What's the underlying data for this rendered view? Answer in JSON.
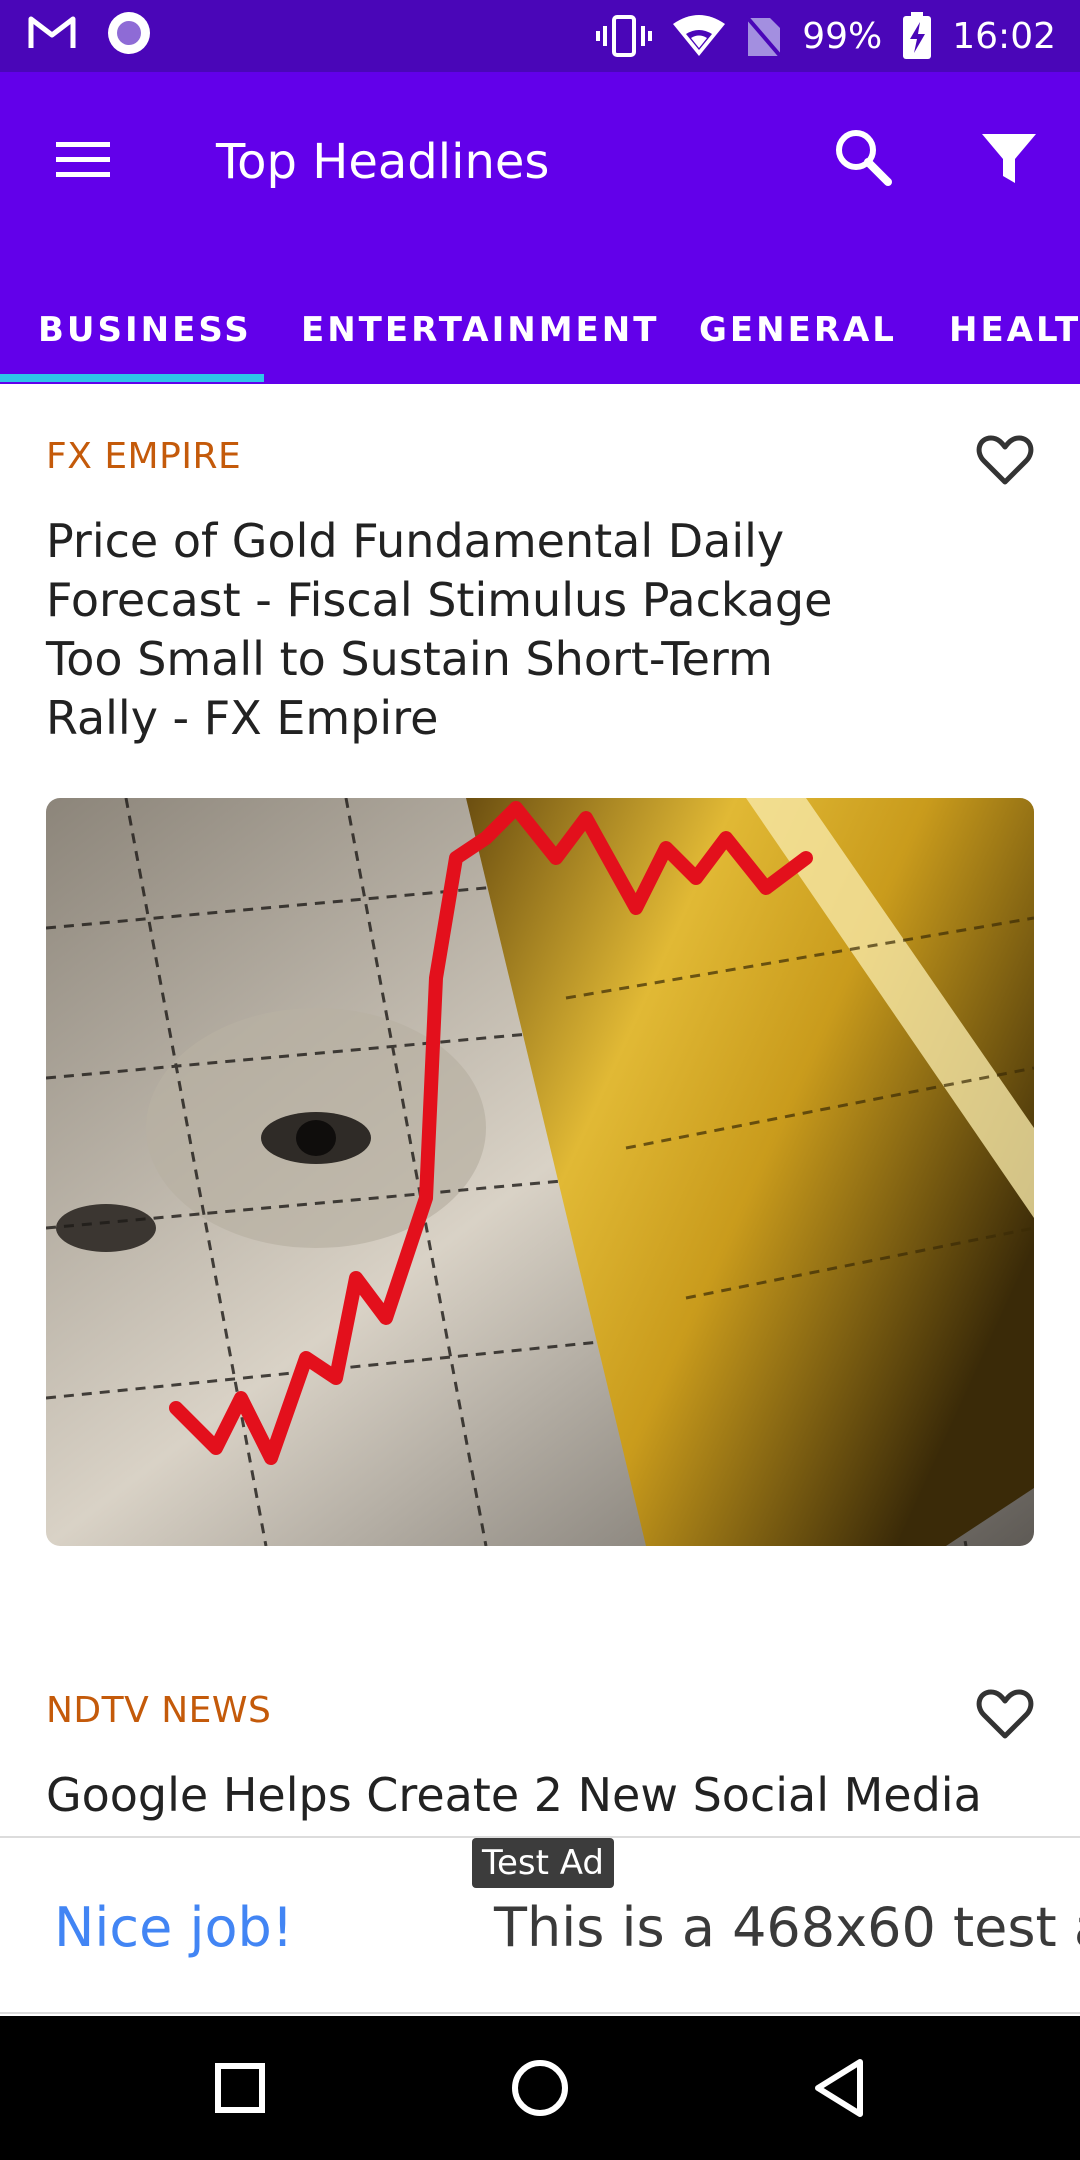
{
  "status_bar": {
    "battery_percent": "99%",
    "time": "16:02",
    "icons": [
      "gmail-icon",
      "app-circle-icon",
      "vibrate-icon",
      "wifi-icon",
      "no-sim-icon",
      "battery-charging-icon"
    ]
  },
  "app_bar": {
    "title": "Top Headlines",
    "icons": [
      "menu-icon",
      "search-icon",
      "filter-icon"
    ],
    "background": "#6200ea"
  },
  "tabs": [
    {
      "label": "BUSINESS",
      "selected": true
    },
    {
      "label": "ENTERTAINMENT",
      "selected": false
    },
    {
      "label": "GENERAL",
      "selected": false
    },
    {
      "label": "HEALTH",
      "selected": false
    }
  ],
  "tab_indicator_color": "#2ec5e9",
  "articles": [
    {
      "source": "FX EMPIRE",
      "headline": "Price of Gold Fundamental Daily Forecast - Fiscal Stimulus Package Too Small to Sustain Short-Term Rally - FX Empire",
      "has_image": true
    },
    {
      "source": "NDTV NEWS",
      "headline": "Google Helps Create 2 New Social Media",
      "has_image": false
    }
  ],
  "ad": {
    "badge": "Test Ad",
    "title": "Nice job!",
    "text": "This is a 468x60 test a"
  },
  "nav_bar": {
    "icons": [
      "recents-icon",
      "home-icon",
      "back-icon"
    ]
  }
}
